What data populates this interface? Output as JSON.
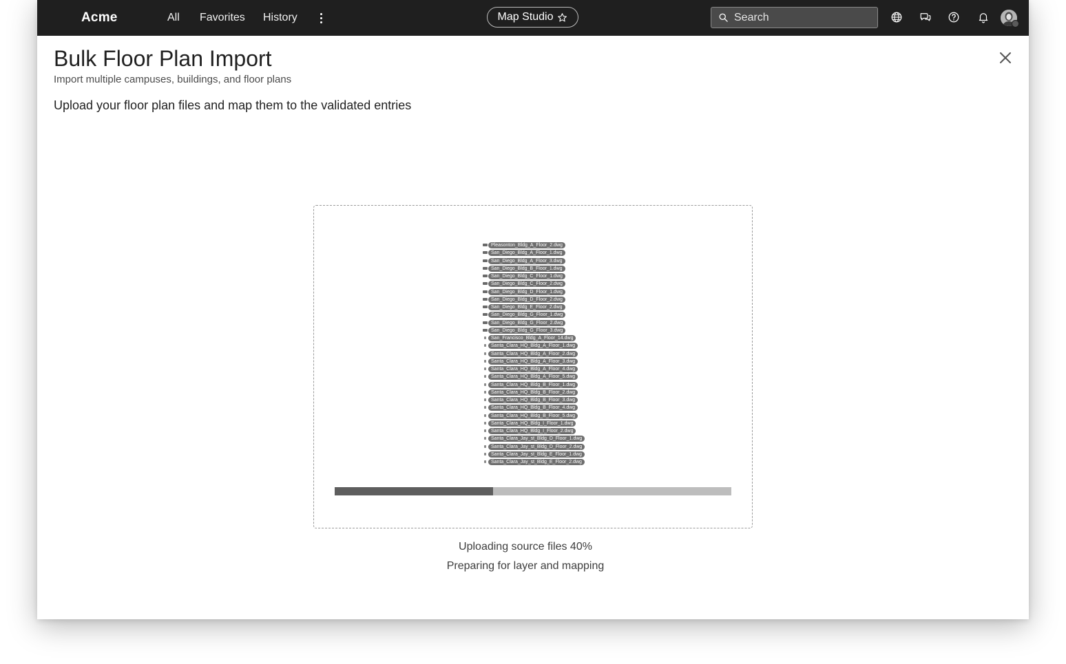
{
  "topbar": {
    "brand": "Acme",
    "nav": [
      "All",
      "Favorites",
      "History"
    ],
    "app_pill": "Map Studio",
    "search_placeholder": "Search"
  },
  "dialog": {
    "title": "Bulk Floor Plan Import",
    "subtitle": "Import multiple campuses, buildings, and floor plans",
    "heading": "Upload your floor plan files and map them to the validated entries"
  },
  "upload": {
    "files": [
      "Pleasonton_Bldg_A_Floor_2.dwg",
      "San_Diego_Bldg_A_Floor_1.dwg",
      "San_Diego_Bldg_A_Floor_3.dwg",
      "San_Diego_Bldg_B_Floor_1.dwg",
      "San_Diego_Bldg_C_Floor_1.dwg",
      "San_Diego_Bldg_C_Floor_2.dwg",
      "San_Diego_Bldg_D_Floor_1.dwg",
      "San_Diego_Bldg_D_Floor_2.dwg",
      "San_Diego_Bldg_E_Floor_2.dwg",
      "San_Diego_Bldg_G_Floor_1.dwg",
      "San_Diego_Bldg_G_Floor_2.dwg",
      "San_Diego_Bldg_G_Floor_3.dwg",
      "San_Francisco_Bldg_A_Floor_14.dwg",
      "Santa_Clara_HQ_Bldg_A_Floor_1.dwg",
      "Santa_Clara_HQ_Bldg_A_Floor_2.dwg",
      "Santa_Clara_HQ_Bldg_A_Floor_3.dwg",
      "Santa_Clara_HQ_Bldg_A_Floor_4.dwg",
      "Santa_Clara_HQ_Bldg_A_Floor_5.dwg",
      "Santa_Clara_HQ_Bldg_B_Floor_1.dwg",
      "Santa_Clara_HQ_Bldg_B_Floor_2.dwg",
      "Santa_Clara_HQ_Bldg_B_Floor_3.dwg",
      "Santa_Clara_HQ_Bldg_B_Floor_4.dwg",
      "Santa_Clara_HQ_Bldg_B_Floor_5.dwg",
      "Santa_Clara_HQ_Bldg_I_Floor_1.dwg",
      "Santa_Clara_HQ_Bldg_I_Floor_2.dwg",
      "Santa_Clara_Jay_st_Bldg_D_Floor_1.dwg",
      "Santa_Clara_Jay_st_Bldg_D_Floor_2.dwg",
      "Santa_Clara_Jay_st_Bldg_E_Floor_1.dwg",
      "Santa_Clara_Jay_st_Bldg_E_Floor_2.dwg"
    ],
    "progress_percent": 40,
    "status_line1": "Uploading source files 40%",
    "status_line2": "Preparing for layer and mapping"
  },
  "colors": {
    "topbar_bg": "#1f1f1f",
    "progress_fill": "#5e5e5e",
    "progress_track": "#bdbdbd"
  },
  "icons": {
    "search": "search-icon",
    "star": "star-icon",
    "more": "more-vertical-icon",
    "globe": "globe-icon",
    "chat": "chat-icon",
    "help": "help-icon",
    "bell": "bell-icon",
    "close": "close-icon"
  }
}
